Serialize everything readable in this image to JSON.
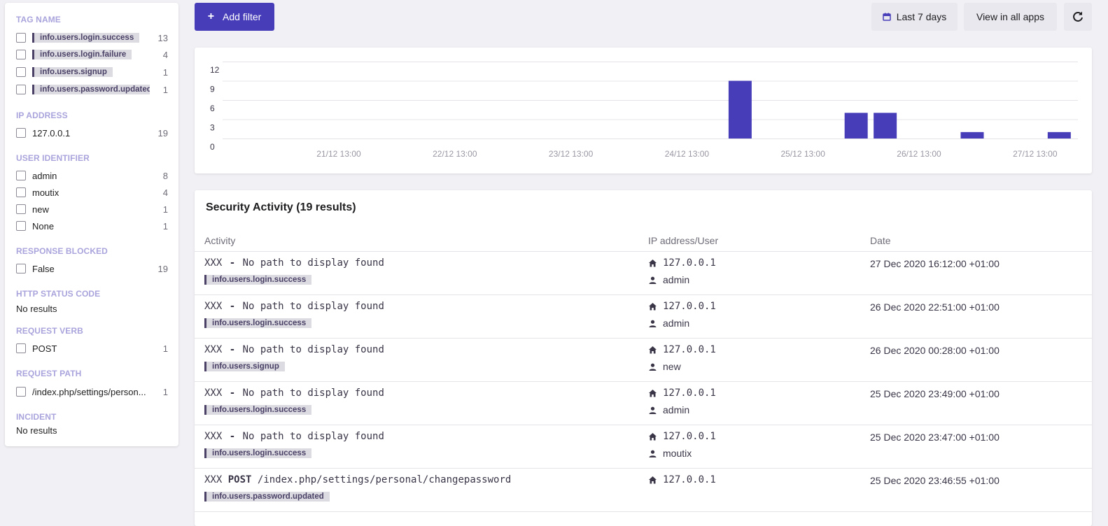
{
  "sidebar": {
    "sections": {
      "tag_name": {
        "title": "TAG NAME",
        "items": [
          {
            "label": "info.users.login.success",
            "count": "13"
          },
          {
            "label": "info.users.login.failure",
            "count": "4"
          },
          {
            "label": "info.users.signup",
            "count": "1"
          },
          {
            "label": "info.users.password.updated",
            "count": "1"
          }
        ]
      },
      "ip_address": {
        "title": "IP ADDRESS",
        "items": [
          {
            "label": "127.0.0.1",
            "count": "19"
          }
        ]
      },
      "user_identifier": {
        "title": "USER IDENTIFIER",
        "items": [
          {
            "label": "admin",
            "count": "8"
          },
          {
            "label": "moutix",
            "count": "4"
          },
          {
            "label": "new",
            "count": "1"
          },
          {
            "label": "None",
            "count": "1"
          }
        ]
      },
      "response_blocked": {
        "title": "RESPONSE BLOCKED",
        "items": [
          {
            "label": "False",
            "count": "19"
          }
        ]
      },
      "http_status_code": {
        "title": "HTTP STATUS CODE",
        "empty": "No results"
      },
      "request_verb": {
        "title": "REQUEST VERB",
        "items": [
          {
            "label": "POST",
            "count": "1"
          }
        ]
      },
      "request_path": {
        "title": "REQUEST PATH",
        "items": [
          {
            "label": "/index.php/settings/person...",
            "count": "1"
          }
        ]
      },
      "incident": {
        "title": "INCIDENT",
        "empty": "No results"
      }
    }
  },
  "toolbar": {
    "add_filter": "Add filter",
    "date_range": "Last 7 days",
    "view_all": "View in all apps",
    "icons": {
      "add": "plus-icon",
      "calendar": "calendar-icon",
      "refresh": "refresh-icon"
    }
  },
  "chart_data": {
    "type": "bar",
    "x_tick_labels": [
      "21/12 13:00",
      "22/12 13:00",
      "23/12 13:00",
      "24/12 13:00",
      "25/12 13:00",
      "26/12 13:00",
      "27/12 13:00"
    ],
    "y_ticks": [
      0,
      3,
      6,
      9,
      12
    ],
    "ylim": [
      0,
      12
    ],
    "bars": [
      {
        "x": "25/12 00:00",
        "value": 9
      },
      {
        "x": "26/12 00:00",
        "value": 4
      },
      {
        "x": "26/12 06:00",
        "value": 4
      },
      {
        "x": "27/12 00:00",
        "value": 1
      },
      {
        "x": "27/12 18:00",
        "value": 1
      }
    ],
    "color": "#473db8",
    "grid": true
  },
  "results": {
    "title": "Security Activity (19 results)",
    "columns": {
      "activity": "Activity",
      "ip_user": "IP address/User",
      "date": "Date"
    },
    "rows": [
      {
        "code": "XXX",
        "sep": "-",
        "verb": "",
        "path": "No path to display found",
        "tag": "info.users.login.success",
        "ip": "127.0.0.1",
        "user": "admin",
        "date": "27 Dec 2020 16:12:00 +01:00"
      },
      {
        "code": "XXX",
        "sep": "-",
        "verb": "",
        "path": "No path to display found",
        "tag": "info.users.login.success",
        "ip": "127.0.0.1",
        "user": "admin",
        "date": "26 Dec 2020 22:51:00 +01:00"
      },
      {
        "code": "XXX",
        "sep": "-",
        "verb": "",
        "path": "No path to display found",
        "tag": "info.users.signup",
        "ip": "127.0.0.1",
        "user": "new",
        "date": "26 Dec 2020 00:28:00 +01:00"
      },
      {
        "code": "XXX",
        "sep": "-",
        "verb": "",
        "path": "No path to display found",
        "tag": "info.users.login.success",
        "ip": "127.0.0.1",
        "user": "admin",
        "date": "25 Dec 2020 23:49:00 +01:00"
      },
      {
        "code": "XXX",
        "sep": "-",
        "verb": "",
        "path": "No path to display found",
        "tag": "info.users.login.success",
        "ip": "127.0.0.1",
        "user": "moutix",
        "date": "25 Dec 2020 23:47:00 +01:00"
      },
      {
        "code": "XXX",
        "sep": "",
        "verb": "POST",
        "path": "/index.php/settings/personal/changepassword",
        "tag": "info.users.password.updated",
        "ip": "127.0.0.1",
        "user": "",
        "date": "25 Dec 2020 23:46:55 +01:00"
      }
    ]
  }
}
